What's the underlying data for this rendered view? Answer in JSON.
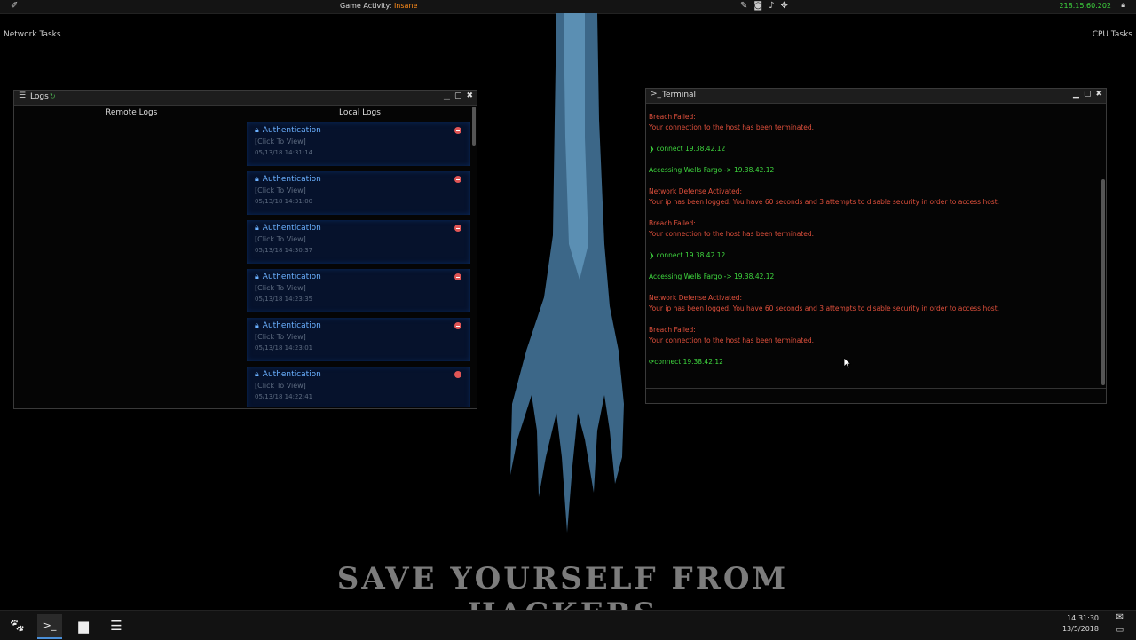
{
  "topbar": {
    "activity_label": "Game Activity:",
    "activity_level": "Insane",
    "ip": "218.15.60.202"
  },
  "desktop": {
    "network_tasks": "Network Tasks",
    "cpu_tasks": "CPU Tasks",
    "slogan": "Save Yourself From Hackers"
  },
  "logs_window": {
    "title": "Logs",
    "remote_heading": "Remote Logs",
    "local_heading": "Local Logs",
    "items": [
      {
        "title": "Authentication",
        "action": "[Click To View]",
        "date": "05/13/18 14:31:14"
      },
      {
        "title": "Authentication",
        "action": "[Click To View]",
        "date": "05/13/18 14:31:00"
      },
      {
        "title": "Authentication",
        "action": "[Click To View]",
        "date": "05/13/18 14:30:37"
      },
      {
        "title": "Authentication",
        "action": "[Click To View]",
        "date": "05/13/18 14:23:35"
      },
      {
        "title": "Authentication",
        "action": "[Click To View]",
        "date": "05/13/18 14:23:01"
      },
      {
        "title": "Authentication",
        "action": "[Click To View]",
        "date": "05/13/18 14:22:41"
      }
    ]
  },
  "terminal_window": {
    "title": "Terminal",
    "lines": {
      "l1": "Breach Failed:",
      "l2": "Your connection to the host has been terminated.",
      "l3": "connect 19.38.42.12",
      "l4": "Accessing Wells Fargo -> 19.38.42.12",
      "l5": "Network Defense Activated:",
      "l6": "Your ip has been logged. You have 60 seconds and 3 attempts to disable security in order to access host.",
      "l7": "Breach Failed:",
      "l8": "Your connection to the host has been terminated.",
      "l9": "connect 19.38.42.12",
      "l10": "Accessing Wells Fargo -> 19.38.42.12",
      "l11": "Network Defense Activated:",
      "l12": "Your ip has been logged. You have 60 seconds and 3 attempts to disable security in order to access host.",
      "l13": "Breach Failed:",
      "l14": "Your connection to the host has been terminated.",
      "l15": "connect 19.38.42.12"
    }
  },
  "taskbar": {
    "time": "14:31:30",
    "date": "13/5/2018"
  },
  "colors": {
    "error": "#e0503c",
    "success": "#3fd83f",
    "log_title": "#6ab0ff",
    "activity": "#ff8c1a"
  }
}
